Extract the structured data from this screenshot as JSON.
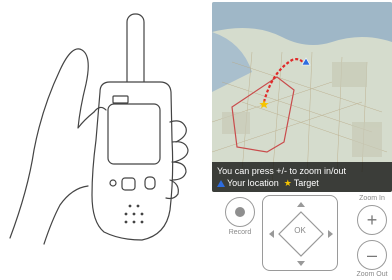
{
  "map": {
    "hint": "You can press +/- to zoom in/out",
    "legend": {
      "location_label": "Your location",
      "target_label": "Target",
      "location_color": "#2d6cdf",
      "target_color": "#f5c400",
      "route_color": "#e02a2a"
    }
  },
  "controls": {
    "record_label": "Record",
    "ok_label": "OK",
    "zoom_in_label": "Zoom In",
    "zoom_out_label": "Zoom Out",
    "zoom_in_glyph": "+",
    "zoom_out_glyph": "–"
  },
  "icons": [
    "hand-device-illustration",
    "triangle-location-icon",
    "star-target-icon",
    "record-icon",
    "dpad-arrow-icons",
    "plus-icon",
    "minus-icon"
  ]
}
